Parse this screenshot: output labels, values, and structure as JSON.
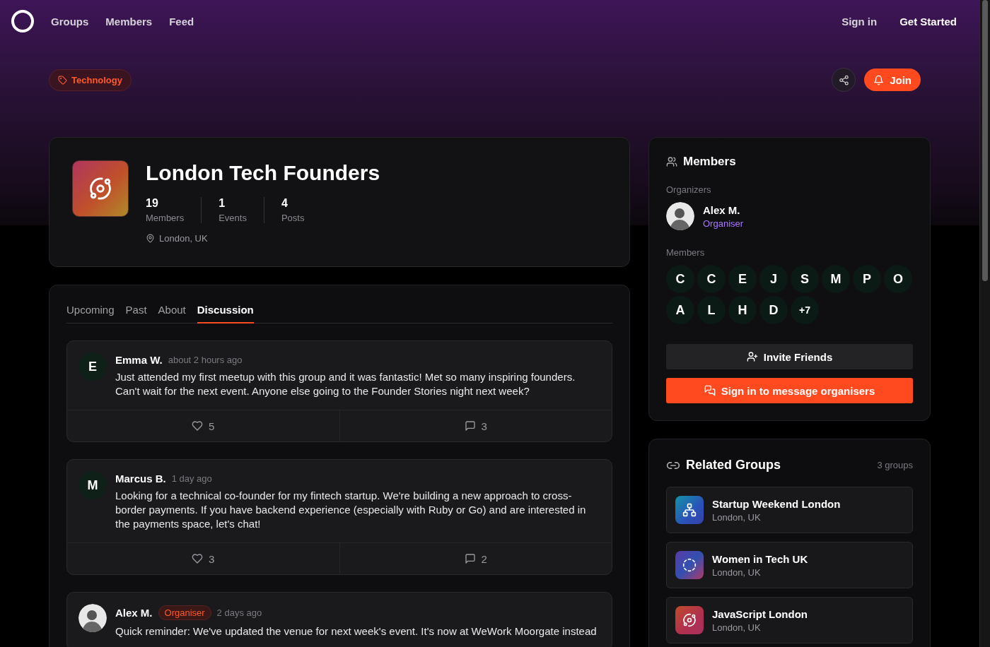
{
  "nav": {
    "links": [
      {
        "label": "Groups"
      },
      {
        "label": "Members"
      },
      {
        "label": "Feed"
      }
    ],
    "sign_in": "Sign in",
    "get_started": "Get Started"
  },
  "category_tag": "Technology",
  "join_button": "Join",
  "group": {
    "name": "London Tech Founders",
    "stats": [
      {
        "value": "19",
        "label": "Members"
      },
      {
        "value": "1",
        "label": "Events"
      },
      {
        "value": "4",
        "label": "Posts"
      }
    ],
    "location": "London, UK"
  },
  "tabs": [
    {
      "label": "Upcoming",
      "selected": false
    },
    {
      "label": "Past",
      "selected": false
    },
    {
      "label": "About",
      "selected": false
    },
    {
      "label": "Discussion",
      "selected": true
    }
  ],
  "posts": [
    {
      "avatar": {
        "kind": "initial",
        "text": "E"
      },
      "author": "Emma W.",
      "time": "about 2 hours ago",
      "text": "Just attended my first meetup with this group and it was fantastic! Met so many inspiring founders. Can't wait for the next event. Anyone else going to the Founder Stories night next week?",
      "likes": "5",
      "comments": "3"
    },
    {
      "avatar": {
        "kind": "initial",
        "text": "M"
      },
      "author": "Marcus B.",
      "time": "1 day ago",
      "text": "Looking for a technical co-founder for my fintech startup. We're building a new approach to cross-border payments. If you have backend experience (especially with Ruby or Go) and are interested in the payments space, let's chat!",
      "likes": "3",
      "comments": "2"
    },
    {
      "avatar": {
        "kind": "photo"
      },
      "author": "Alex M.",
      "badge": "Organiser",
      "time": "2 days ago",
      "text": "Quick reminder: We've updated the venue for next week's event. It's now at WeWork Moorgate instead"
    }
  ],
  "members_panel": {
    "title": "Members",
    "organizers_label": "Organizers",
    "organizers": [
      {
        "name": "Alex M.",
        "role": "Organiser"
      }
    ],
    "members_label": "Members",
    "avatars": [
      "C",
      "C",
      "E",
      "J",
      "S",
      "M",
      "P",
      "O",
      "A",
      "L",
      "H",
      "D",
      "+7"
    ],
    "invite_button": "Invite Friends",
    "message_button": "Sign in to message organisers"
  },
  "related": {
    "title": "Related Groups",
    "count": "3 groups",
    "groups": [
      {
        "name": "Startup Weekend London",
        "location": "London, UK",
        "kind": "network"
      },
      {
        "name": "Women in Tech UK",
        "location": "London, UK",
        "kind": "dashed-circle"
      },
      {
        "name": "JavaScript London",
        "location": "London, UK",
        "kind": "orbit"
      }
    ]
  }
}
